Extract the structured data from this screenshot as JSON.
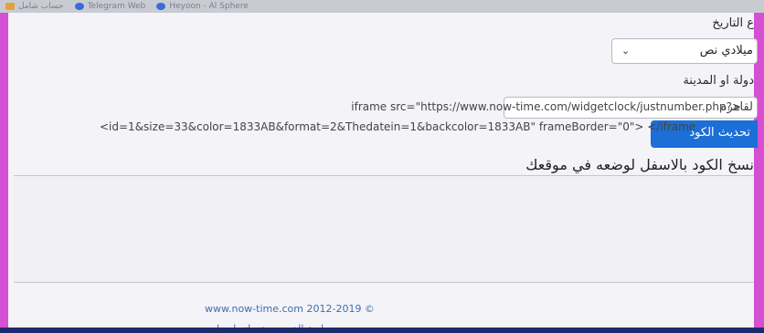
{
  "bookmarks": [
    {
      "label": "حساب شامل",
      "icon": "bookmark-icon"
    },
    {
      "label": "Telegram Web",
      "icon": "telegram-icon"
    },
    {
      "label": "Heyoon - Al Sphere",
      "icon": "site-icon"
    }
  ],
  "form": {
    "date_type_label": "ع التاريخ",
    "date_type_value": "ميلادي نص",
    "city_label": "دولة او المدينة",
    "city_value": "لقاهرة",
    "update_button": "تحديث الكود",
    "copy_note": "نسخ الكود بالاسفل لوضعه في موقعك"
  },
  "code": {
    "line1": "iframe src=\"https://www.now-time.com/widgetclock/justnumber.php?>",
    "line2": "<id=1&size=33&color=1833AB&format=2&Thedatein=1&backcolor=1833AB\" frameBorder=\"0\"> </iframe"
  },
  "footer": {
    "copyright": "www.now-time.com 2012-2019 ©",
    "links": "سياسة الخصوصية - اتصل بنا"
  },
  "colors": {
    "frame": "#d44fd3",
    "button": "#1b6fd6",
    "link": "#3c6fb0"
  }
}
